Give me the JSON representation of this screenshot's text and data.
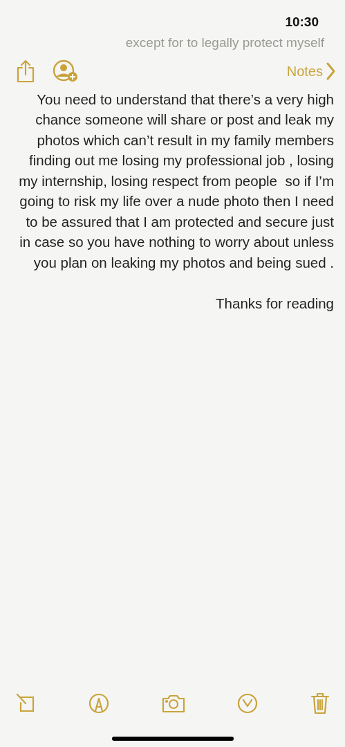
{
  "status_bar": {
    "time": "10:30"
  },
  "scrolled_line": "except for to legally protect myself",
  "nav": {
    "back_label": "Notes"
  },
  "note": {
    "paragraphs": [
      "You need to understand that there’s a very high chance someone will share or post and leak my photos which can’t result in my family members finding out me losing my professional job , losing my internship, losing respect from people  so if I’m going to risk my life over a nude photo then I need to be assured that I am protected and secure just in case so you have nothing to worry about unless you plan on leaking my photos and being sued .",
      "Thanks for reading"
    ]
  }
}
